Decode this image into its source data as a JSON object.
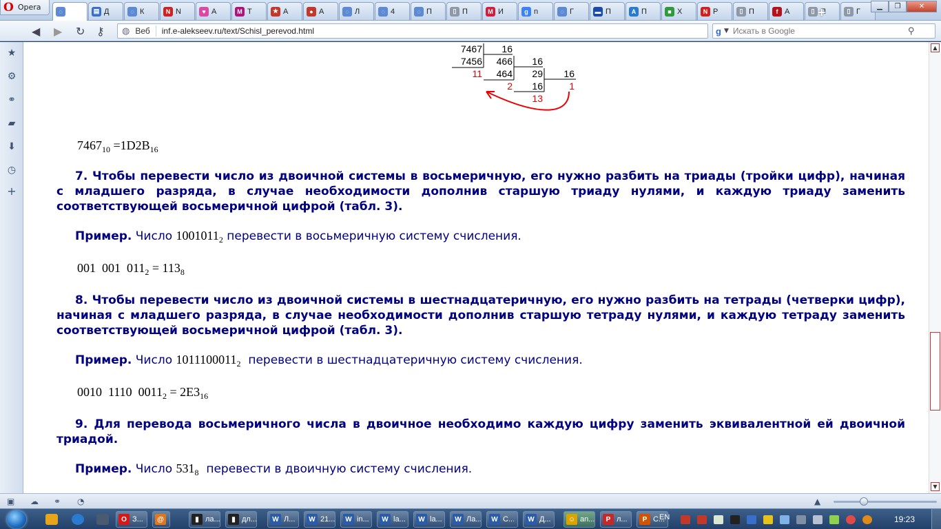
{
  "browser": {
    "menu_label": "Opera",
    "tabs": [
      {
        "label": "",
        "icon": "loading-icon",
        "color": "#5d8ad3",
        "glyph": "◌",
        "active": true
      },
      {
        "label": "Д",
        "icon": "blue-site-icon",
        "color": "#3a6fc9",
        "glyph": "▤"
      },
      {
        "label": "К",
        "icon": "loading-icon",
        "color": "#5d8ad3",
        "glyph": "◌"
      },
      {
        "label": "N",
        "icon": "n-logo-icon",
        "color": "#cc2222",
        "glyph": "N"
      },
      {
        "label": "А",
        "icon": "heart-icon",
        "color": "#d84aa3",
        "glyph": "♥"
      },
      {
        "label": "Т",
        "icon": "m-logo-icon",
        "color": "#b0127a",
        "glyph": "M"
      },
      {
        "label": "А",
        "icon": "star-icon",
        "color": "#c0392b",
        "glyph": "★"
      },
      {
        "label": "А",
        "icon": "cherry-icon",
        "color": "#c0392b",
        "glyph": "●"
      },
      {
        "label": "Л",
        "icon": "loading-icon",
        "color": "#5d8ad3",
        "glyph": "◌"
      },
      {
        "label": "4",
        "icon": "loading-icon",
        "color": "#5d8ad3",
        "glyph": "◌"
      },
      {
        "label": "П",
        "icon": "loading-icon",
        "color": "#5d8ad3",
        "glyph": "◌"
      },
      {
        "label": "П",
        "icon": "page-icon",
        "color": "#8d99a8",
        "glyph": "▯"
      },
      {
        "label": "И",
        "icon": "m-logo-icon",
        "color": "#d01f3c",
        "glyph": "M"
      },
      {
        "label": "n",
        "icon": "google-icon",
        "color": "#3b82f6",
        "glyph": "g"
      },
      {
        "label": "Г",
        "icon": "loading-icon",
        "color": "#5d8ad3",
        "glyph": "◌"
      },
      {
        "label": "П",
        "icon": "flag-icon",
        "color": "#1c4aa8",
        "glyph": "▬"
      },
      {
        "label": "П",
        "icon": "translate-icon",
        "color": "#2a7bd0",
        "glyph": "A"
      },
      {
        "label": "Х",
        "icon": "green-site-icon",
        "color": "#2e9a3a",
        "glyph": "■"
      },
      {
        "label": "Р",
        "icon": "n-logo-icon",
        "color": "#cc2222",
        "glyph": "N"
      },
      {
        "label": "П",
        "icon": "page-icon",
        "color": "#8d99a8",
        "glyph": "▯"
      },
      {
        "label": "А",
        "icon": "f-logo-icon",
        "color": "#b5121b",
        "glyph": "f"
      },
      {
        "label": "П",
        "icon": "page-icon",
        "color": "#8d99a8",
        "glyph": "▯"
      },
      {
        "label": "Г",
        "icon": "page-icon",
        "color": "#8d99a8",
        "glyph": "▯"
      }
    ],
    "new_tab_label": "+",
    "address": {
      "web_label": "Веб",
      "url": "inf.e-alekseev.ru/text/Schisl_perevod.html"
    },
    "search": {
      "engine_letter": "g",
      "placeholder": "Искать в Google"
    }
  },
  "content": {
    "division": {
      "rows": [
        {
          "text": "7467",
          "red": false
        },
        {
          "text": "16",
          "red": false
        },
        {
          "text": "7456",
          "red": false
        },
        {
          "text": "466",
          "red": false
        },
        {
          "text": "16",
          "red": false
        },
        {
          "text": "11",
          "red": true
        },
        {
          "text": "464",
          "red": false
        },
        {
          "text": "29",
          "red": false
        },
        {
          "text": "16",
          "red": false
        },
        {
          "text": "2",
          "red": true
        },
        {
          "text": "16",
          "red": false
        },
        {
          "text": "1",
          "red": true
        },
        {
          "text": "13",
          "red": true
        }
      ]
    },
    "result1": {
      "base": "7467",
      "base_sub": "10",
      "eq": "=1D2B",
      "eq_sub": "16"
    },
    "rule7": "7. Чтобы перевести число из двоичной системы в восьмеричную, его нужно разбить на триады (тройки цифр), начиная с младшего разряда, в случае необходимости дополнив старшую триаду нулями, и каждую триаду заменить соответствующей восьмеричной цифрой (табл. 3).",
    "example7": {
      "label": "Пример.",
      "before": "Число",
      "number": "1001011",
      "sub": "2",
      "after": "перевести в восьмеричную систему счисления."
    },
    "formula7": {
      "left": "001  001  011",
      "left_sub": "2",
      "right": "= 113",
      "right_sub": "8"
    },
    "rule8": "8. Чтобы перевести число из двоичной системы в шестнадцатеричную, его нужно разбить на тетрады (четверки цифр), начиная с младшего разряда, в случае необходимости дополнив старшую тетраду нулями, и каждую тетраду заменить соответствующей восьмеричной цифрой (табл. 3).",
    "example8": {
      "label": "Пример.",
      "before": "Число",
      "number": "1011100011",
      "sub": "2",
      "after": " перевести в шестнадцатеричную систему счисления."
    },
    "formula8": {
      "left": "0010  1110  0011",
      "left_sub": "2",
      "right": "= 2E3",
      "right_sub": "16"
    },
    "rule9": "9. Для перевода восьмеричного числа в двоичное необходимо каждую цифру заменить эквивалентной ей двоичной триадой.",
    "example9": {
      "label": "Пример.",
      "before": "Число",
      "number": "531",
      "sub": "8",
      "after": " перевести в двоичную систему счисления."
    }
  },
  "taskbar": {
    "buttons": [
      {
        "label": "З...",
        "icon": "opera-icon",
        "color": "#d51818",
        "glyph": "O",
        "width": 46,
        "active": false
      },
      {
        "label": "",
        "icon": "at-icon",
        "color": "#e0771c",
        "glyph": "@",
        "width": 26,
        "active": false
      },
      {
        "label": "ла...",
        "icon": "console-icon",
        "color": "#222222",
        "glyph": "▮",
        "width": 46,
        "active": false
      },
      {
        "label": "дл...",
        "icon": "console-icon",
        "color": "#222222",
        "glyph": "▮",
        "width": 46,
        "active": false
      },
      {
        "label": "Л...",
        "icon": "word-icon",
        "color": "#2a5caa",
        "glyph": "W",
        "width": 46,
        "active": false
      },
      {
        "label": "21...",
        "icon": "word-icon",
        "color": "#2a5caa",
        "glyph": "W",
        "width": 46,
        "active": false
      },
      {
        "label": "in...",
        "icon": "word-icon",
        "color": "#2a5caa",
        "glyph": "W",
        "width": 46,
        "active": false
      },
      {
        "label": "la...",
        "icon": "word-icon",
        "color": "#2a5caa",
        "glyph": "W",
        "width": 46,
        "active": false
      },
      {
        "label": "la...",
        "icon": "word-icon",
        "color": "#2a5caa",
        "glyph": "W",
        "width": 46,
        "active": false
      },
      {
        "label": "Ла...",
        "icon": "word-icon",
        "color": "#2a5caa",
        "glyph": "W",
        "width": 46,
        "active": false
      },
      {
        "label": "С...",
        "icon": "word-icon",
        "color": "#2a5caa",
        "glyph": "W",
        "width": 46,
        "active": false
      },
      {
        "label": "Д...",
        "icon": "word-icon",
        "color": "#2a5caa",
        "glyph": "W",
        "width": 46,
        "active": false
      },
      {
        "label": "an...",
        "icon": "app-icon",
        "color": "#d9a400",
        "glyph": "☺",
        "width": 46,
        "active": true
      },
      {
        "label": "л...",
        "icon": "pdf-icon",
        "color": "#c62828",
        "glyph": "P",
        "width": 46,
        "active": false
      },
      {
        "label": "С...",
        "icon": "powerpoint-icon",
        "color": "#d35400",
        "glyph": "P",
        "width": 46,
        "active": false
      }
    ],
    "lang": "EN",
    "clock": "19:23"
  }
}
